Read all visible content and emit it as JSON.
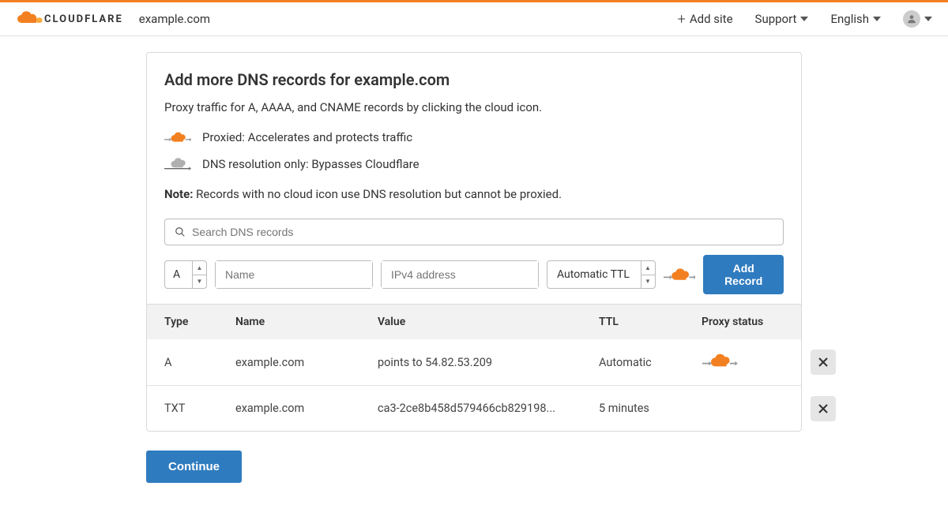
{
  "header": {
    "site_name": "example.com",
    "add_site": "Add site",
    "support": "Support",
    "language": "English"
  },
  "page": {
    "title": "Add more DNS records for example.com",
    "subtitle": "Proxy traffic for A, AAAA, and CNAME records by clicking the cloud icon.",
    "legend_proxied": "Proxied: Accelerates and protects traffic",
    "legend_dns_only": "DNS resolution only: Bypasses Cloudflare",
    "note_label": "Note:",
    "note_text": " Records with no cloud icon use DNS resolution but cannot be proxied."
  },
  "search": {
    "placeholder": "Search DNS records"
  },
  "add_form": {
    "type": "A",
    "name_placeholder": "Name",
    "value_placeholder": "IPv4 address",
    "ttl": "Automatic TTL",
    "add_button": "Add Record"
  },
  "table": {
    "headers": {
      "type": "Type",
      "name": "Name",
      "value": "Value",
      "ttl": "TTL",
      "proxy": "Proxy status"
    },
    "rows": [
      {
        "type": "A",
        "name": "example.com",
        "value": "points to 54.82.53.209",
        "ttl": "Automatic",
        "proxied": true
      },
      {
        "type": "TXT",
        "name": "example.com",
        "value": "ca3-2ce8b458d579466cb829198...",
        "ttl": "5 minutes",
        "proxied": null
      }
    ]
  },
  "footer": {
    "continue": "Continue"
  },
  "colors": {
    "orange": "#f38020",
    "blue": "#2f7bbf",
    "gray": "#999"
  }
}
